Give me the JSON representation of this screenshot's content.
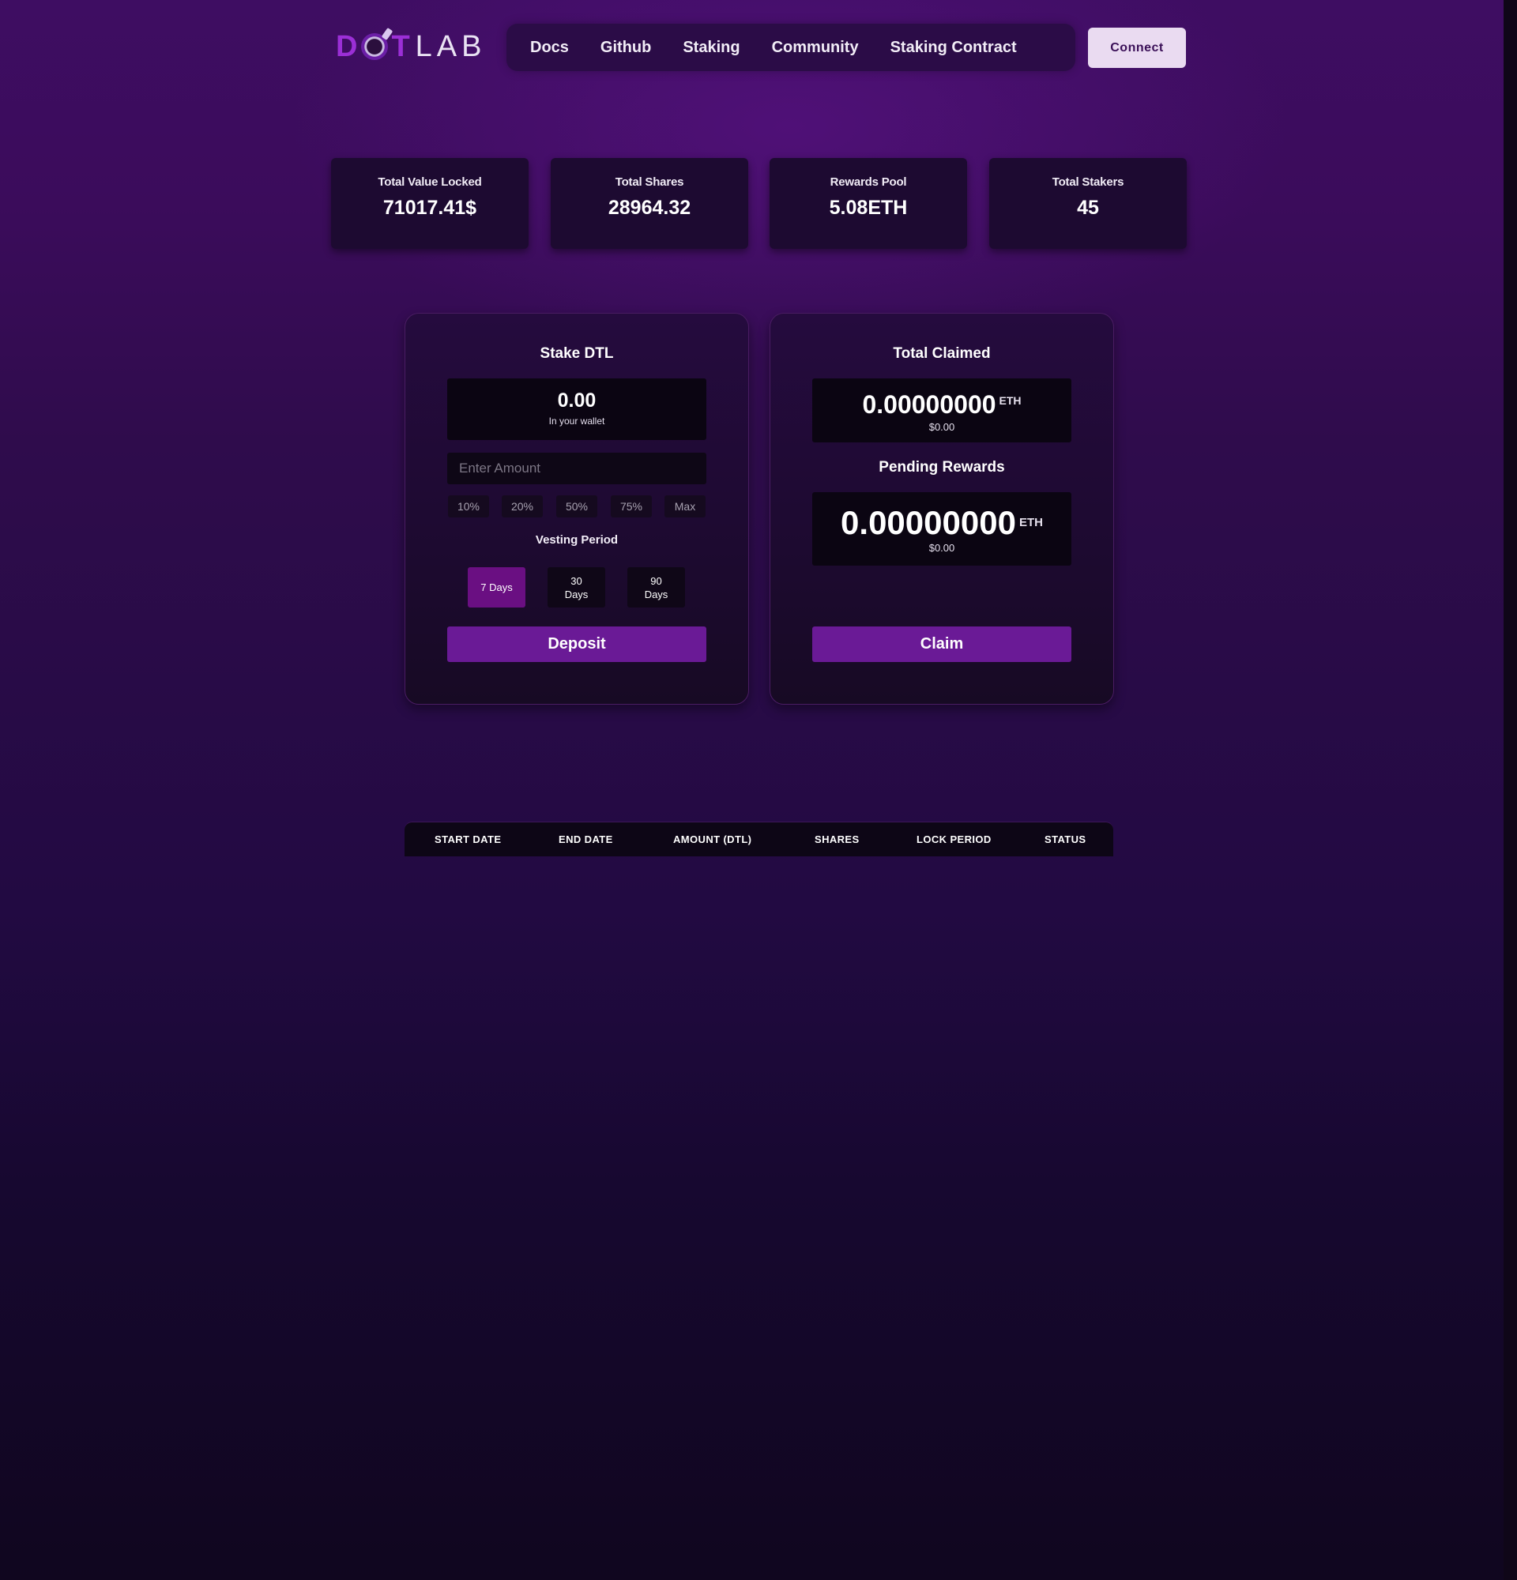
{
  "header": {
    "logo": {
      "part1": "D",
      "part2": "T",
      "part3": "LAB"
    },
    "nav": [
      "Docs",
      "Github",
      "Staking",
      "Community",
      "Staking Contract"
    ],
    "connect_label": "Connect"
  },
  "stats": [
    {
      "label": "Total Value Locked",
      "value": "71017.41$"
    },
    {
      "label": "Total Shares",
      "value": "28964.32"
    },
    {
      "label": "Rewards Pool",
      "value": "5.08ETH"
    },
    {
      "label": "Total Stakers",
      "value": "45"
    }
  ],
  "stake": {
    "title": "Stake DTL",
    "wallet_balance": "0.00",
    "wallet_label": "In your wallet",
    "amount_placeholder": "Enter Amount",
    "amount_value": "",
    "percent_buttons": [
      "10%",
      "20%",
      "50%",
      "75%",
      "Max"
    ],
    "vesting_label": "Vesting Period",
    "vesting_options": [
      {
        "line1": "7 Days",
        "line2": "",
        "selected": true
      },
      {
        "line1": "30",
        "line2": "Days",
        "selected": false
      },
      {
        "line1": "90",
        "line2": "Days",
        "selected": false
      }
    ],
    "deposit_label": "Deposit"
  },
  "rewards": {
    "claimed_title": "Total Claimed",
    "claimed_value": "0.00000000",
    "claimed_unit": "ETH",
    "claimed_usd": "$0.00",
    "pending_title": "Pending Rewards",
    "pending_value": "0.00000000",
    "pending_unit": "ETH",
    "pending_usd": "$0.00",
    "claim_label": "Claim"
  },
  "table": {
    "columns": [
      "Start Date",
      "End Date",
      "Amount (DTL)",
      "Shares",
      "Lock Period",
      "Status"
    ]
  },
  "colors": {
    "accent": "#6a1a96",
    "selected_vesting": "#6a0f82",
    "logo": "#9b2fd6",
    "connect_bg": "#eadbf1"
  }
}
